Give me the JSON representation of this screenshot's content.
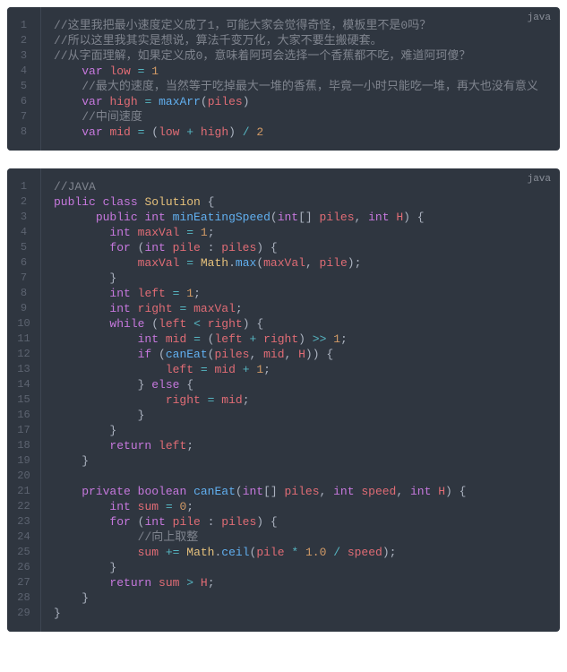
{
  "blocks": [
    {
      "lang": "java",
      "lines": [
        [
          [
            "c",
            "//这里我把最小速度定义成了1，可能大家会觉得奇怪，模板里不是0吗？"
          ]
        ],
        [
          [
            "c",
            "//所以这里我其实是想说，算法千变万化，大家不要生搬硬套。"
          ]
        ],
        [
          [
            "c",
            "//从字面理解，如果定义成0，意味着阿珂会选择一个香蕉都不吃，难道阿珂傻？"
          ]
        ],
        [
          [
            "p",
            "    "
          ],
          [
            "kw",
            "var"
          ],
          [
            "p",
            " "
          ],
          [
            "va",
            "low"
          ],
          [
            "p",
            " "
          ],
          [
            "op",
            "="
          ],
          [
            "p",
            " "
          ],
          [
            "nu",
            "1"
          ]
        ],
        [
          [
            "p",
            "    "
          ],
          [
            "c",
            "//最大的速度，当然等于吃掉最大一堆的香蕉，毕竟一小时只能吃一堆，再大也没有意义"
          ]
        ],
        [
          [
            "p",
            "    "
          ],
          [
            "kw",
            "var"
          ],
          [
            "p",
            " "
          ],
          [
            "va",
            "high"
          ],
          [
            "p",
            " "
          ],
          [
            "op",
            "="
          ],
          [
            "p",
            " "
          ],
          [
            "fn",
            "maxArr"
          ],
          [
            "p",
            "("
          ],
          [
            "va",
            "piles"
          ],
          [
            "p",
            ")"
          ]
        ],
        [
          [
            "p",
            "    "
          ],
          [
            "c",
            "//中间速度"
          ]
        ],
        [
          [
            "p",
            "    "
          ],
          [
            "kw",
            "var"
          ],
          [
            "p",
            " "
          ],
          [
            "va",
            "mid"
          ],
          [
            "p",
            " "
          ],
          [
            "op",
            "="
          ],
          [
            "p",
            " ("
          ],
          [
            "va",
            "low"
          ],
          [
            "p",
            " "
          ],
          [
            "op",
            "+"
          ],
          [
            "p",
            " "
          ],
          [
            "va",
            "high"
          ],
          [
            "p",
            ") "
          ],
          [
            "op",
            "/"
          ],
          [
            "p",
            " "
          ],
          [
            "nu",
            "2"
          ]
        ]
      ]
    },
    {
      "lang": "java",
      "lines": [
        [
          [
            "c",
            "//JAVA"
          ]
        ],
        [
          [
            "kw",
            "public"
          ],
          [
            "p",
            " "
          ],
          [
            "kw",
            "class"
          ],
          [
            "p",
            " "
          ],
          [
            "cls",
            "Solution"
          ],
          [
            "p",
            " {"
          ]
        ],
        [
          [
            "p",
            "      "
          ],
          [
            "kw",
            "public"
          ],
          [
            "p",
            " "
          ],
          [
            "ty",
            "int"
          ],
          [
            "p",
            " "
          ],
          [
            "fn",
            "minEatingSpeed"
          ],
          [
            "p",
            "("
          ],
          [
            "ty",
            "int"
          ],
          [
            "p",
            "[] "
          ],
          [
            "va",
            "piles"
          ],
          [
            "p",
            ", "
          ],
          [
            "ty",
            "int"
          ],
          [
            "p",
            " "
          ],
          [
            "va",
            "H"
          ],
          [
            "p",
            ") {"
          ]
        ],
        [
          [
            "p",
            "        "
          ],
          [
            "ty",
            "int"
          ],
          [
            "p",
            " "
          ],
          [
            "va",
            "maxVal"
          ],
          [
            "p",
            " "
          ],
          [
            "op",
            "="
          ],
          [
            "p",
            " "
          ],
          [
            "nu",
            "1"
          ],
          [
            "p",
            ";"
          ]
        ],
        [
          [
            "p",
            "        "
          ],
          [
            "kw",
            "for"
          ],
          [
            "p",
            " ("
          ],
          [
            "ty",
            "int"
          ],
          [
            "p",
            " "
          ],
          [
            "va",
            "pile"
          ],
          [
            "p",
            " : "
          ],
          [
            "va",
            "piles"
          ],
          [
            "p",
            ") {"
          ]
        ],
        [
          [
            "p",
            "            "
          ],
          [
            "va",
            "maxVal"
          ],
          [
            "p",
            " "
          ],
          [
            "op",
            "="
          ],
          [
            "p",
            " "
          ],
          [
            "cls",
            "Math"
          ],
          [
            "p",
            "."
          ],
          [
            "fn",
            "max"
          ],
          [
            "p",
            "("
          ],
          [
            "va",
            "maxVal"
          ],
          [
            "p",
            ", "
          ],
          [
            "va",
            "pile"
          ],
          [
            "p",
            ");"
          ]
        ],
        [
          [
            "p",
            "        }"
          ]
        ],
        [
          [
            "p",
            "        "
          ],
          [
            "ty",
            "int"
          ],
          [
            "p",
            " "
          ],
          [
            "va",
            "left"
          ],
          [
            "p",
            " "
          ],
          [
            "op",
            "="
          ],
          [
            "p",
            " "
          ],
          [
            "nu",
            "1"
          ],
          [
            "p",
            ";"
          ]
        ],
        [
          [
            "p",
            "        "
          ],
          [
            "ty",
            "int"
          ],
          [
            "p",
            " "
          ],
          [
            "va",
            "right"
          ],
          [
            "p",
            " "
          ],
          [
            "op",
            "="
          ],
          [
            "p",
            " "
          ],
          [
            "va",
            "maxVal"
          ],
          [
            "p",
            ";"
          ]
        ],
        [
          [
            "p",
            "        "
          ],
          [
            "kw",
            "while"
          ],
          [
            "p",
            " ("
          ],
          [
            "va",
            "left"
          ],
          [
            "p",
            " "
          ],
          [
            "op",
            "<"
          ],
          [
            "p",
            " "
          ],
          [
            "va",
            "right"
          ],
          [
            "p",
            ") {"
          ]
        ],
        [
          [
            "p",
            "            "
          ],
          [
            "ty",
            "int"
          ],
          [
            "p",
            " "
          ],
          [
            "va",
            "mid"
          ],
          [
            "p",
            " "
          ],
          [
            "op",
            "="
          ],
          [
            "p",
            " ("
          ],
          [
            "va",
            "left"
          ],
          [
            "p",
            " "
          ],
          [
            "op",
            "+"
          ],
          [
            "p",
            " "
          ],
          [
            "va",
            "right"
          ],
          [
            "p",
            ") "
          ],
          [
            "op",
            ">>"
          ],
          [
            "p",
            " "
          ],
          [
            "nu",
            "1"
          ],
          [
            "p",
            ";"
          ]
        ],
        [
          [
            "p",
            "            "
          ],
          [
            "kw",
            "if"
          ],
          [
            "p",
            " ("
          ],
          [
            "fn",
            "canEat"
          ],
          [
            "p",
            "("
          ],
          [
            "va",
            "piles"
          ],
          [
            "p",
            ", "
          ],
          [
            "va",
            "mid"
          ],
          [
            "p",
            ", "
          ],
          [
            "va",
            "H"
          ],
          [
            "p",
            ")) {"
          ]
        ],
        [
          [
            "p",
            "                "
          ],
          [
            "va",
            "left"
          ],
          [
            "p",
            " "
          ],
          [
            "op",
            "="
          ],
          [
            "p",
            " "
          ],
          [
            "va",
            "mid"
          ],
          [
            "p",
            " "
          ],
          [
            "op",
            "+"
          ],
          [
            "p",
            " "
          ],
          [
            "nu",
            "1"
          ],
          [
            "p",
            ";"
          ]
        ],
        [
          [
            "p",
            "            } "
          ],
          [
            "kw",
            "else"
          ],
          [
            "p",
            " {"
          ]
        ],
        [
          [
            "p",
            "                "
          ],
          [
            "va",
            "right"
          ],
          [
            "p",
            " "
          ],
          [
            "op",
            "="
          ],
          [
            "p",
            " "
          ],
          [
            "va",
            "mid"
          ],
          [
            "p",
            ";"
          ]
        ],
        [
          [
            "p",
            "            }"
          ]
        ],
        [
          [
            "p",
            "        }"
          ]
        ],
        [
          [
            "p",
            "        "
          ],
          [
            "kw",
            "return"
          ],
          [
            "p",
            " "
          ],
          [
            "va",
            "left"
          ],
          [
            "p",
            ";"
          ]
        ],
        [
          [
            "p",
            "    }"
          ]
        ],
        [
          [
            "p",
            " "
          ]
        ],
        [
          [
            "p",
            "    "
          ],
          [
            "kw",
            "private"
          ],
          [
            "p",
            " "
          ],
          [
            "ty",
            "boolean"
          ],
          [
            "p",
            " "
          ],
          [
            "fn",
            "canEat"
          ],
          [
            "p",
            "("
          ],
          [
            "ty",
            "int"
          ],
          [
            "p",
            "[] "
          ],
          [
            "va",
            "piles"
          ],
          [
            "p",
            ", "
          ],
          [
            "ty",
            "int"
          ],
          [
            "p",
            " "
          ],
          [
            "va",
            "speed"
          ],
          [
            "p",
            ", "
          ],
          [
            "ty",
            "int"
          ],
          [
            "p",
            " "
          ],
          [
            "va",
            "H"
          ],
          [
            "p",
            ") {"
          ]
        ],
        [
          [
            "p",
            "        "
          ],
          [
            "ty",
            "int"
          ],
          [
            "p",
            " "
          ],
          [
            "va",
            "sum"
          ],
          [
            "p",
            " "
          ],
          [
            "op",
            "="
          ],
          [
            "p",
            " "
          ],
          [
            "nu",
            "0"
          ],
          [
            "p",
            ";"
          ]
        ],
        [
          [
            "p",
            "        "
          ],
          [
            "kw",
            "for"
          ],
          [
            "p",
            " ("
          ],
          [
            "ty",
            "int"
          ],
          [
            "p",
            " "
          ],
          [
            "va",
            "pile"
          ],
          [
            "p",
            " : "
          ],
          [
            "va",
            "piles"
          ],
          [
            "p",
            ") {"
          ]
        ],
        [
          [
            "p",
            "            "
          ],
          [
            "c",
            "//向上取整"
          ]
        ],
        [
          [
            "p",
            "            "
          ],
          [
            "va",
            "sum"
          ],
          [
            "p",
            " "
          ],
          [
            "op",
            "+="
          ],
          [
            "p",
            " "
          ],
          [
            "cls",
            "Math"
          ],
          [
            "p",
            "."
          ],
          [
            "fn",
            "ceil"
          ],
          [
            "p",
            "("
          ],
          [
            "va",
            "pile"
          ],
          [
            "p",
            " "
          ],
          [
            "op",
            "*"
          ],
          [
            "p",
            " "
          ],
          [
            "nu",
            "1.0"
          ],
          [
            "p",
            " "
          ],
          [
            "op",
            "/"
          ],
          [
            "p",
            " "
          ],
          [
            "va",
            "speed"
          ],
          [
            "p",
            ");"
          ]
        ],
        [
          [
            "p",
            "        }"
          ]
        ],
        [
          [
            "p",
            "        "
          ],
          [
            "kw",
            "return"
          ],
          [
            "p",
            " "
          ],
          [
            "va",
            "sum"
          ],
          [
            "p",
            " "
          ],
          [
            "op",
            ">"
          ],
          [
            "p",
            " "
          ],
          [
            "va",
            "H"
          ],
          [
            "p",
            ";"
          ]
        ],
        [
          [
            "p",
            "    }"
          ]
        ],
        [
          [
            "p",
            "}"
          ]
        ]
      ]
    }
  ]
}
